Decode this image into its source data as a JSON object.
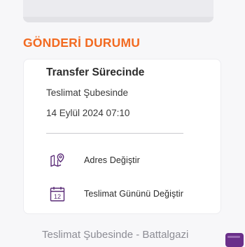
{
  "section": {
    "title": "GÖNDERİ DURUMU"
  },
  "status": {
    "title": "Transfer Sürecinde",
    "location": "Teslimat Şubesinde",
    "datetime": "14 Eylül 2024 07:10"
  },
  "actions": [
    {
      "label": "Adres Değiştir",
      "icon": "map-pin-icon"
    },
    {
      "label": "Teslimat Gününü Değiştir",
      "icon": "calendar-icon",
      "icon_text": "12"
    }
  ],
  "next_status": {
    "label": "Teslimat Şubesinde - Battalgazi"
  },
  "colors": {
    "accent": "#f26a21",
    "brand": "#6a2f8a",
    "text": "#2b2b2b",
    "muted": "#8c8c94"
  }
}
